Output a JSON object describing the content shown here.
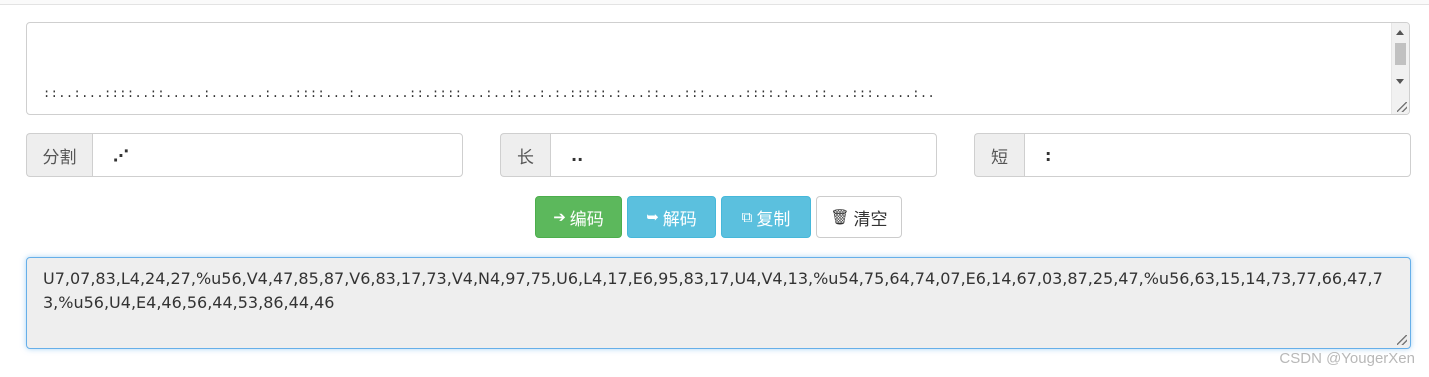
{
  "encoded_text": {
    "lines": [
      "::..:...::::..::.....:.......:...::::...:.......::.::::...:..::..:.:.:::::.:...::...:::.....::::.:...::...:::.....:..",
      ":::...::...:.....:.:.:.:::::.....::...::::.....:..:....:::.:.....:.....:.:::.....:::.......:::::::...::.......:::.....:::....::",
      ":....:::.:..:..:::::...:::.......::::.....::....:.......:..::::...:::.......:::::::..::.......::::..:...:.....::..:::.:.:"
    ],
    "scroll_up_icon": "triangle-up-icon",
    "scroll_down_icon": "triangle-down-icon"
  },
  "fields": {
    "separator": {
      "label": "分割",
      "value": "⋰"
    },
    "long": {
      "label": "长",
      "value": ".."
    },
    "short": {
      "label": "短",
      "value": ":"
    }
  },
  "buttons": {
    "encode": {
      "icon": "sign-in-icon",
      "glyph": "➔",
      "label": "编码",
      "color": "#5cb85c"
    },
    "decode": {
      "icon": "sign-out-icon",
      "glyph": "➥",
      "label": "解码",
      "color": "#5bc0de"
    },
    "copy": {
      "icon": "copy-icon",
      "glyph": "⧉",
      "label": "复制",
      "color": "#5bc0de"
    },
    "clear": {
      "icon": "trash-icon",
      "glyph": "🗑",
      "label": "清空",
      "color": "#ffffff"
    }
  },
  "output": {
    "text": "U7,07,83,L4,24,27,%u56,V4,47,85,87,V6,83,17,73,V4,N4,97,75,U6,L4,17,E6,95,83,17,U4,V4,13,%u54,75,64,74,07,E6,14,67,03,87,25,47,%u56,63,15,14,73,77,66,47,73,%u56,U4,E4,46,56,44,53,86,44,46"
  },
  "watermark": "CSDN @YougerXen"
}
